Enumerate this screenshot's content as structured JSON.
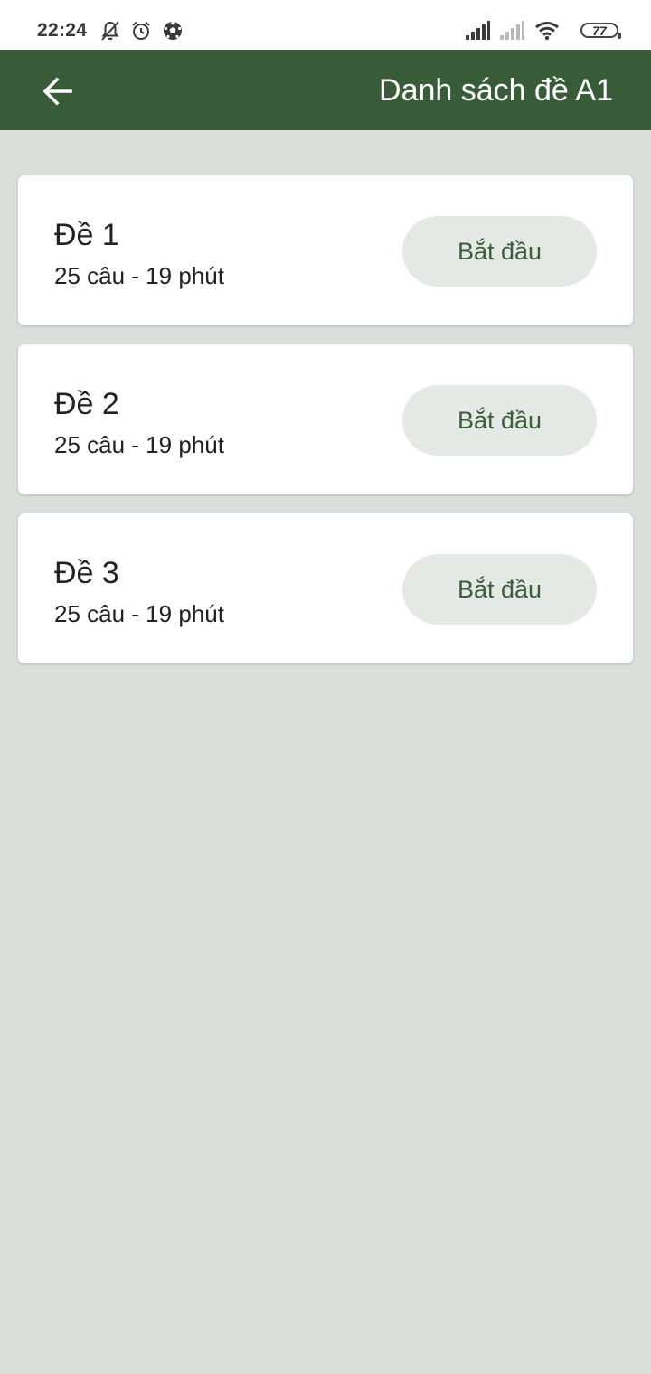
{
  "status_bar": {
    "time": "22:24",
    "battery_level": "77",
    "icons_left": [
      "notifications-off-icon",
      "alarm-icon",
      "soccer-ball-icon"
    ],
    "icons_right": [
      "signal-strong-icon",
      "signal-weak-icon",
      "wifi-icon",
      "battery-icon"
    ]
  },
  "app_bar": {
    "back_icon": "arrow-left-icon",
    "title": "Danh sách đề A1",
    "color": "#385c38"
  },
  "exams": [
    {
      "title": "Đề 1",
      "meta": "25 câu - 19 phút",
      "button_label": "Bắt đầu"
    },
    {
      "title": "Đề 2",
      "meta": "25 câu - 19 phút",
      "button_label": "Bắt đầu"
    },
    {
      "title": "Đề 3",
      "meta": "25 câu - 19 phút",
      "button_label": "Bắt đầu"
    }
  ],
  "colors": {
    "background": "#dadfdb",
    "button_bg": "#e5e9e5",
    "button_text": "#3a5f3a"
  }
}
